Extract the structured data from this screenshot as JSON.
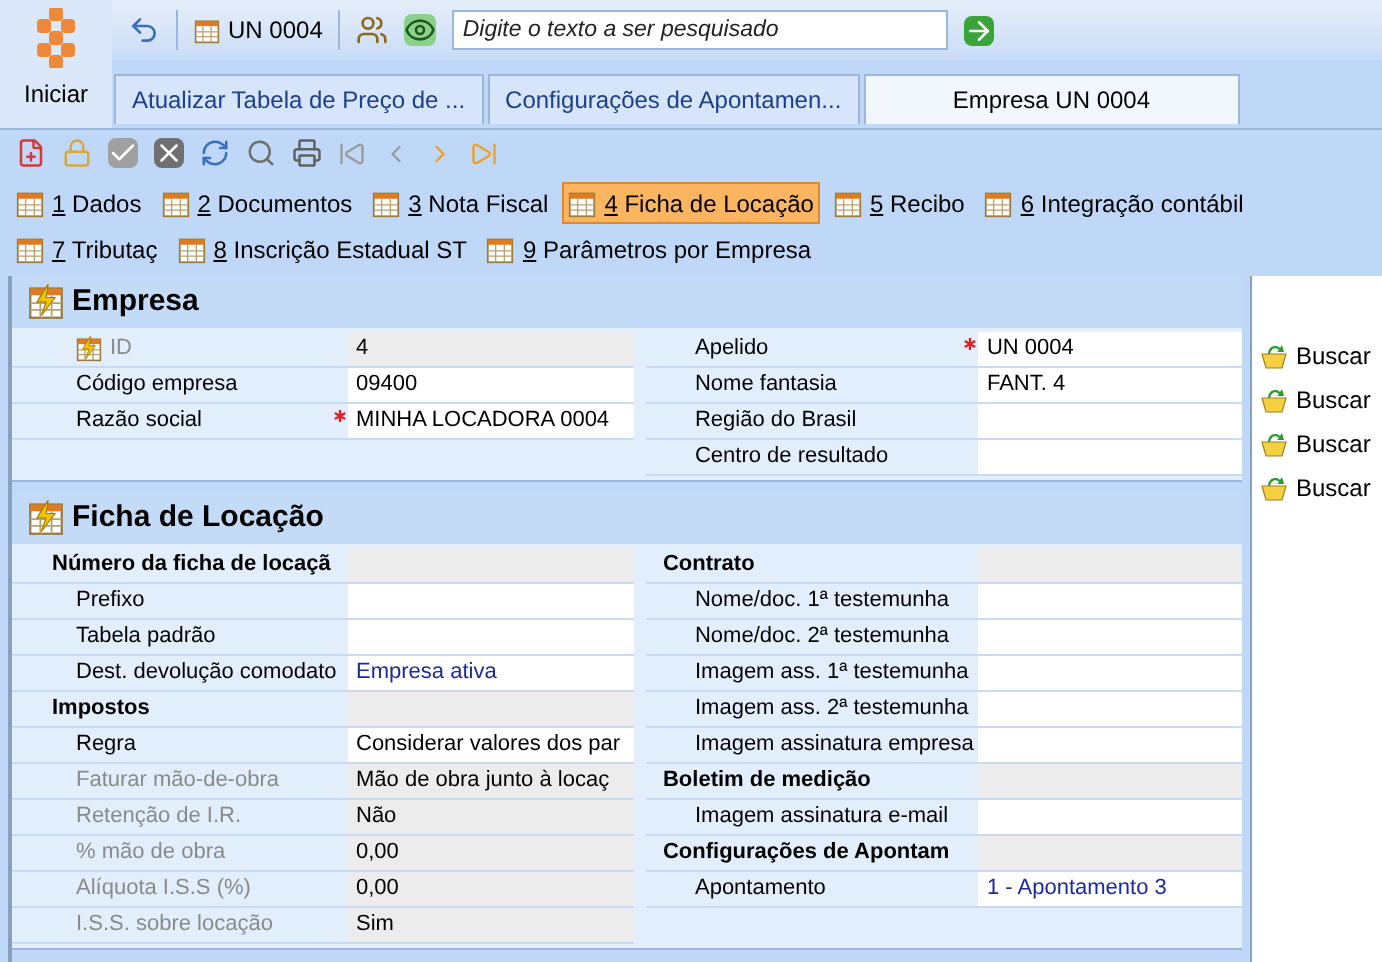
{
  "start_button": {
    "label": "Iniciar"
  },
  "quick_bar": {
    "record": "UN 0004",
    "search": {
      "placeholder": "Digite o texto a ser pesquisado"
    }
  },
  "doc_tabs": [
    {
      "label": "Atualizar Tabela de Preço de ...",
      "selected": false
    },
    {
      "label": "Configurações de Apontamen...",
      "selected": false
    },
    {
      "label": "Empresa UN 0004",
      "selected": true
    }
  ],
  "section_tabs": [
    {
      "number": "1",
      "label": "Dados",
      "selected": false
    },
    {
      "number": "2",
      "label": "Documentos",
      "selected": false
    },
    {
      "number": "3",
      "label": "Nota Fiscal",
      "selected": false
    },
    {
      "number": "4",
      "label": "Ficha de Locação",
      "selected": true
    },
    {
      "number": "5",
      "label": "Recibo",
      "selected": false
    },
    {
      "number": "6",
      "label": "Integração contábil",
      "selected": false
    },
    {
      "number": "7",
      "label": "Tributaç",
      "selected": false
    },
    {
      "number": "8",
      "label": "Inscrição Estadual ST",
      "selected": false
    },
    {
      "number": "9",
      "label": "Parâmetros por Empresa",
      "selected": false
    }
  ],
  "sections": [
    {
      "title": "Empresa",
      "columns": [
        [
          {
            "kind": "field",
            "label": "ID",
            "value": "4",
            "readonly": true,
            "disabled": true,
            "required": false,
            "key_icon": true
          },
          {
            "kind": "field",
            "label": "Código empresa",
            "value": "09400",
            "readonly": false,
            "disabled": false,
            "required": false
          },
          {
            "kind": "field",
            "label": "Razão social",
            "value": "MINHA LOCADORA 0004",
            "readonly": false,
            "disabled": false,
            "required": true
          }
        ],
        [
          {
            "kind": "field",
            "label": "Apelido",
            "value": "UN 0004",
            "readonly": false,
            "disabled": false,
            "required": true
          },
          {
            "kind": "field",
            "label": "Nome fantasia",
            "value": "FANT. 4",
            "readonly": false,
            "disabled": false,
            "required": false
          },
          {
            "kind": "field",
            "label": "Região do Brasil",
            "readonly": false,
            "disabled": false,
            "required": false
          },
          {
            "kind": "field",
            "label": "Centro de resultado",
            "readonly": false,
            "disabled": false,
            "required": false
          }
        ]
      ]
    },
    {
      "title": "Ficha de Locação",
      "columns": [
        [
          {
            "kind": "group",
            "label": "Número da ficha de locaçã"
          },
          {
            "kind": "field",
            "label": "Prefixo",
            "readonly": false,
            "disabled": false,
            "required": false
          },
          {
            "kind": "field",
            "label": "Tabela padrão",
            "readonly": false,
            "disabled": false,
            "required": false
          },
          {
            "kind": "field",
            "label": "Dest. devolução comodato",
            "value": "Empresa ativa",
            "readonly": false,
            "disabled": false,
            "required": false,
            "link": true
          },
          {
            "kind": "group",
            "label": "Impostos"
          },
          {
            "kind": "field",
            "label": "Regra",
            "value": "Considerar valores dos par",
            "readonly": false,
            "disabled": false,
            "required": false
          },
          {
            "kind": "field",
            "label": "Faturar mão-de-obra",
            "value": "Mão de obra junto à locaç",
            "readonly": true,
            "disabled": true,
            "required": false
          },
          {
            "kind": "field",
            "label": "Retenção de I.R.",
            "value": "Não",
            "readonly": true,
            "disabled": true,
            "required": false
          },
          {
            "kind": "field",
            "label": "% mão de obra",
            "value": "0,00",
            "readonly": true,
            "disabled": true,
            "required": false
          },
          {
            "kind": "field",
            "label": "Alíquota I.S.S (%)",
            "value": "0,00",
            "readonly": true,
            "disabled": true,
            "required": false
          },
          {
            "kind": "field",
            "label": "I.S.S. sobre locação",
            "value": "Sim",
            "readonly": true,
            "disabled": true,
            "required": false
          }
        ],
        [
          {
            "kind": "group",
            "label": "Contrato"
          },
          {
            "kind": "field",
            "label": "Nome/doc. 1ª testemunha",
            "readonly": false,
            "disabled": false,
            "required": false
          },
          {
            "kind": "field",
            "label": "Nome/doc. 2ª testemunha",
            "readonly": false,
            "disabled": false,
            "required": false
          },
          {
            "kind": "field",
            "label": "Imagem ass. 1ª testemunha",
            "readonly": false,
            "disabled": false,
            "required": false
          },
          {
            "kind": "field",
            "label": "Imagem ass. 2ª testemunha",
            "readonly": false,
            "disabled": false,
            "required": false
          },
          {
            "kind": "field",
            "label": "Imagem assinatura empresa",
            "readonly": false,
            "disabled": false,
            "required": false
          },
          {
            "kind": "group",
            "label": "Boletim de medição"
          },
          {
            "kind": "field",
            "label": "Imagem assinatura e-mail",
            "readonly": false,
            "disabled": false,
            "required": false
          },
          {
            "kind": "group",
            "label": "Configurações de Apontam"
          },
          {
            "kind": "field",
            "label": "Apontamento",
            "value": "1 - Apontamento 3",
            "readonly": false,
            "disabled": false,
            "required": false,
            "link": true
          }
        ]
      ]
    }
  ],
  "side_actions": [
    "Buscar",
    "Buscar",
    "Buscar",
    "Buscar"
  ]
}
